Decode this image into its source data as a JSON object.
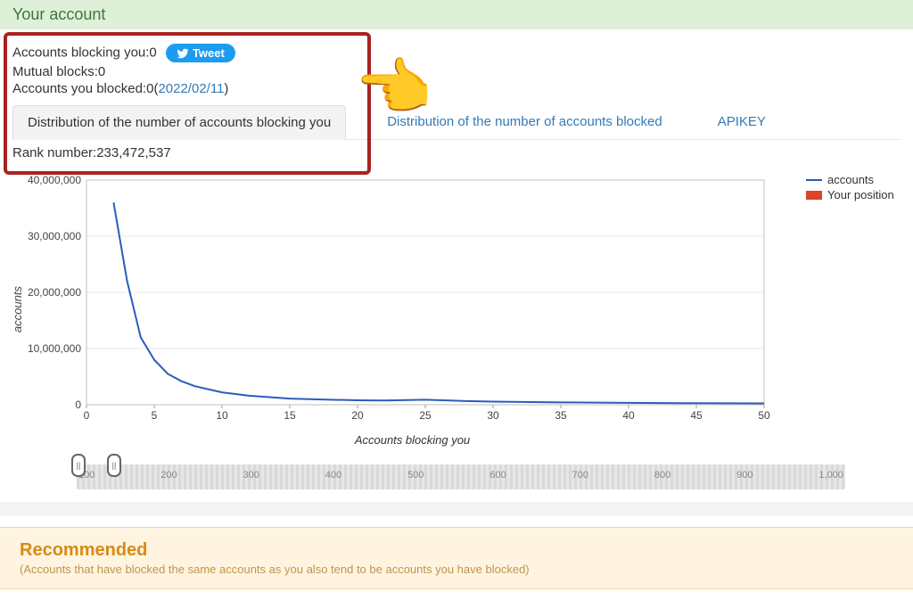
{
  "header": {
    "title": "Your account"
  },
  "stats": {
    "blocking_you_label": "Accounts blocking you:",
    "blocking_you_value": "0",
    "mutual_label": "Mutual blocks:",
    "mutual_value": "0",
    "you_blocked_label": "Accounts you blocked:",
    "you_blocked_value": "0",
    "you_blocked_date": "2022/02/11",
    "rank_label": "Rank number:",
    "rank_value": "233,472,537",
    "tweet_label": "Tweet"
  },
  "tabs": {
    "t1": "Distribution of the number of accounts blocking you",
    "t2": "Distribution of the number of accounts blocked",
    "t3": "APIKEY"
  },
  "legend": {
    "accounts": "accounts",
    "your_position": "Your position"
  },
  "slider_ticks": [
    "100",
    "200",
    "300",
    "400",
    "500",
    "600",
    "700",
    "800",
    "900",
    "1,000"
  ],
  "recommended": {
    "title": "Recommended",
    "sub": "(Accounts that have blocked the same accounts as you also tend to be accounts you have blocked)"
  },
  "chart_data": {
    "type": "line",
    "title": "",
    "xlabel": "Accounts blocking you",
    "ylabel": "accounts",
    "xlim": [
      0,
      50
    ],
    "ylim": [
      0,
      40000000
    ],
    "xticks": [
      0,
      5,
      10,
      15,
      20,
      25,
      30,
      35,
      40,
      45,
      50
    ],
    "yticks": [
      0,
      10000000,
      20000000,
      30000000,
      40000000
    ],
    "ytick_labels": [
      "0",
      "10,000,000",
      "20,000,000",
      "30,000,000",
      "40,000,000"
    ],
    "series": [
      {
        "name": "accounts",
        "x": [
          2,
          3,
          4,
          5,
          6,
          7,
          8,
          10,
          12,
          15,
          18,
          20,
          22,
          25,
          28,
          30,
          35,
          40,
          45,
          50
        ],
        "y": [
          36000000,
          22000000,
          12000000,
          8000000,
          5500000,
          4200000,
          3300000,
          2200000,
          1600000,
          1100000,
          900000,
          800000,
          750000,
          900000,
          650000,
          550000,
          420000,
          330000,
          270000,
          230000
        ]
      }
    ],
    "your_position": null
  }
}
